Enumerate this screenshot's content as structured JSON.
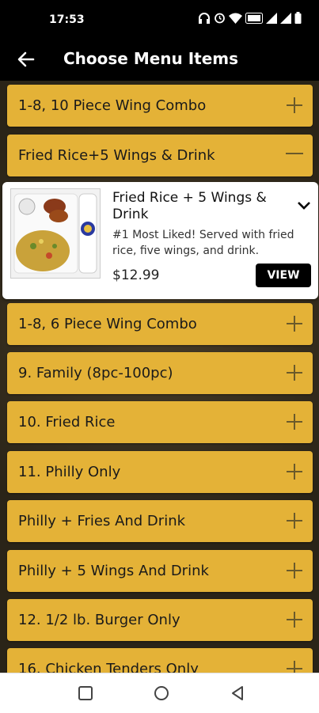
{
  "status_bar": {
    "time": "17:53",
    "icons": [
      "headphones-icon",
      "alarm-icon",
      "wifi-icon",
      "volte-icon",
      "signal-icon",
      "signal-icon",
      "battery-icon"
    ]
  },
  "header": {
    "title": "Choose Menu Items",
    "back_icon": "arrow-left-icon"
  },
  "categories": [
    {
      "label": "1-8, 10 Piece Wing Combo",
      "state": "collapsed"
    },
    {
      "label": "Fried Rice+5 Wings & Drink",
      "state": "expanded"
    },
    {
      "label": "1-8, 6 Piece Wing Combo",
      "state": "collapsed"
    },
    {
      "label": "9. Family (8pc-100pc)",
      "state": "collapsed"
    },
    {
      "label": "10. Fried Rice",
      "state": "collapsed"
    },
    {
      "label": "11. Philly Only",
      "state": "collapsed"
    },
    {
      "label": "Philly + Fries And Drink",
      "state": "collapsed"
    },
    {
      "label": "Philly + 5 Wings And Drink",
      "state": "collapsed"
    },
    {
      "label": "12. 1/2 lb. Burger Only",
      "state": "collapsed"
    },
    {
      "label": "16. Chicken Tenders Only",
      "state": "collapsed"
    }
  ],
  "expanded_item": {
    "name": "Fried Rice + 5 Wings & Drink",
    "description": "#1 Most Liked! Served with fried rice, five wings, and drink.",
    "price": "$12.99",
    "view_label": "VIEW"
  },
  "colors": {
    "category_bg": "#e4b237",
    "header_bg": "#000000",
    "card_bg": "#ffffff"
  },
  "nav": [
    "square-icon",
    "circle-icon",
    "triangle-back-icon"
  ]
}
